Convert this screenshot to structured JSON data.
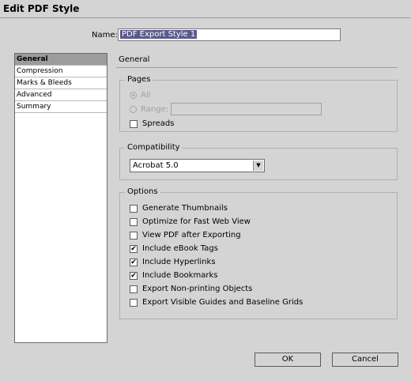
{
  "window": {
    "title": "Edit PDF Style"
  },
  "name_field": {
    "label": "Name:",
    "value": "PDF Export Style 1"
  },
  "sidebar": {
    "items": [
      {
        "label": "General",
        "active": true
      },
      {
        "label": "Compression",
        "active": false
      },
      {
        "label": "Marks & Bleeds",
        "active": false
      },
      {
        "label": "Advanced",
        "active": false
      },
      {
        "label": "Summary",
        "active": false
      }
    ]
  },
  "main": {
    "section_title": "General",
    "pages": {
      "label": "Pages",
      "all_label": "All",
      "range_label": "Range:",
      "range_value": "",
      "spreads_label": "Spreads"
    },
    "compatibility": {
      "label": "Compatibility",
      "selected": "Acrobat 5.0"
    },
    "options": {
      "label": "Options",
      "items": [
        {
          "label": "Generate Thumbnails",
          "checked": false
        },
        {
          "label": "Optimize for Fast Web View",
          "checked": false
        },
        {
          "label": "View PDF after Exporting",
          "checked": false
        },
        {
          "label": "Include eBook Tags",
          "checked": true
        },
        {
          "label": "Include Hyperlinks",
          "checked": true
        },
        {
          "label": "Include Bookmarks",
          "checked": true
        },
        {
          "label": "Export Non-printing Objects",
          "checked": false
        },
        {
          "label": "Export Visible Guides and Baseline Grids",
          "checked": false
        }
      ]
    }
  },
  "buttons": {
    "ok": "OK",
    "cancel": "Cancel"
  }
}
